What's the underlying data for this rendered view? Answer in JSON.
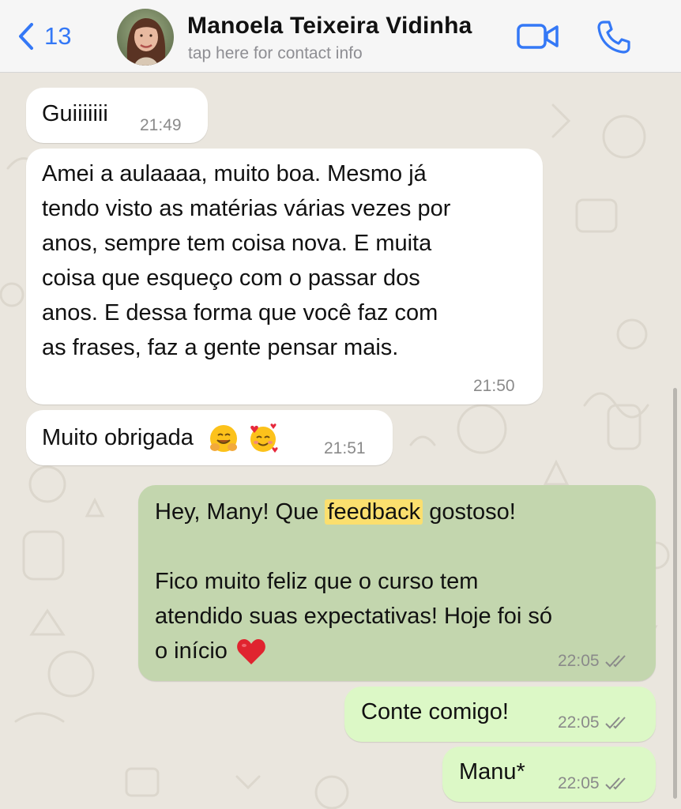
{
  "header": {
    "back_count": "13",
    "contact_name": "Manoela Teixeira Vidinha",
    "contact_subtitle": "tap here for contact info",
    "icons": [
      "chevron-left-icon",
      "video-camera-icon",
      "phone-icon"
    ],
    "accent_color": "#3478f6"
  },
  "messages": [
    {
      "direction": "in",
      "text": "Guiiiiiii",
      "time": "21:49"
    },
    {
      "direction": "in",
      "text": "Amei a aulaaaa, muito boa. Mesmo já tendo visto as matérias várias vezes por anos, sempre tem coisa nova. E muita coisa que esqueço com o passar dos anos. E dessa forma que você faz com as frases, faz a gente pensar mais.",
      "lines": [
        "Amei a aulaaaa, muito boa. Mesmo já",
        "tendo visto as matérias várias vezes por",
        "anos, sempre tem coisa nova. E muita",
        "coisa que esqueço com o passar dos",
        "anos. E dessa forma que você faz com",
        "as frases, faz a gente pensar mais."
      ],
      "time": "21:50"
    },
    {
      "direction": "in",
      "text": "Muito obrigada",
      "emojis": [
        "hugging-face-emoji",
        "smiling-face-with-hearts-emoji"
      ],
      "time": "21:51"
    },
    {
      "direction": "out",
      "text_before": "Hey, Many! Que ",
      "highlighted": "feedback",
      "text_after": " gostoso!",
      "paragraph2": [
        "Fico muito feliz que o curso tem",
        "atendido suas expectativas! Hoje foi só",
        "o início"
      ],
      "emoji": "red-heart-emoji",
      "time": "22:05",
      "status": "read",
      "highlight_color": "#fbdf6e"
    },
    {
      "direction": "out",
      "text": "Conte comigo!",
      "time": "22:05",
      "status": "read"
    },
    {
      "direction": "out",
      "text": "Manu*",
      "time": "22:05",
      "status": "read"
    }
  ],
  "colors": {
    "incoming_bubble": "#ffffff",
    "outgoing_bubble": "#dcf8c6",
    "outgoing_selected_bubble": "#c3d6ae",
    "chat_background": "#eae6de"
  }
}
